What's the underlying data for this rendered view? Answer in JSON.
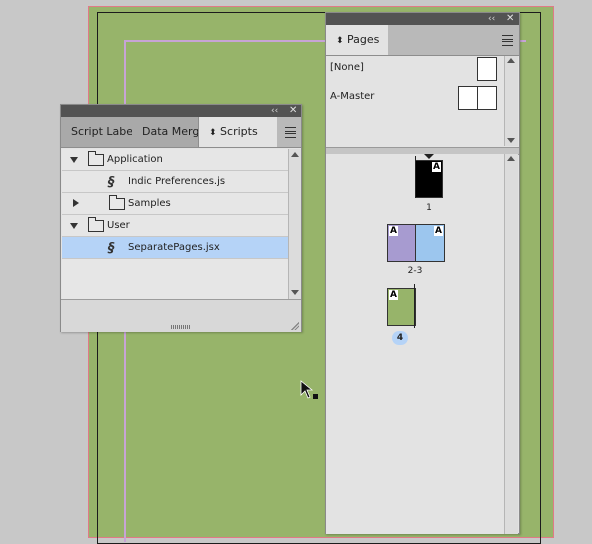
{
  "scripts_panel": {
    "tabs": [
      "Script Labe",
      "Data Merg",
      "Scripts"
    ],
    "tree": [
      {
        "label": "Application",
        "type": "folder",
        "expanded": true,
        "indent": 0
      },
      {
        "label": "Indic Preferences.js",
        "type": "script",
        "indent": 2
      },
      {
        "label": "Samples",
        "type": "folder",
        "expanded": false,
        "indent": 1
      },
      {
        "label": "User",
        "type": "folder",
        "expanded": true,
        "indent": 0
      },
      {
        "label": "SeparatePages.jsx",
        "type": "script",
        "indent": 2,
        "selected": true
      }
    ]
  },
  "pages_panel": {
    "tab": "Pages",
    "masters": [
      "[None]",
      "A-Master"
    ],
    "page_labels": [
      "1",
      "2-3",
      "4"
    ],
    "master_prefix": "A",
    "current_page": "4"
  },
  "colors": {
    "page_green": "#97b46a",
    "panel_bg": "#e3e3e3",
    "selection": "#b5d3f7",
    "page2_purple": "#a79bd0",
    "page3_blue": "#9cc6ee"
  }
}
